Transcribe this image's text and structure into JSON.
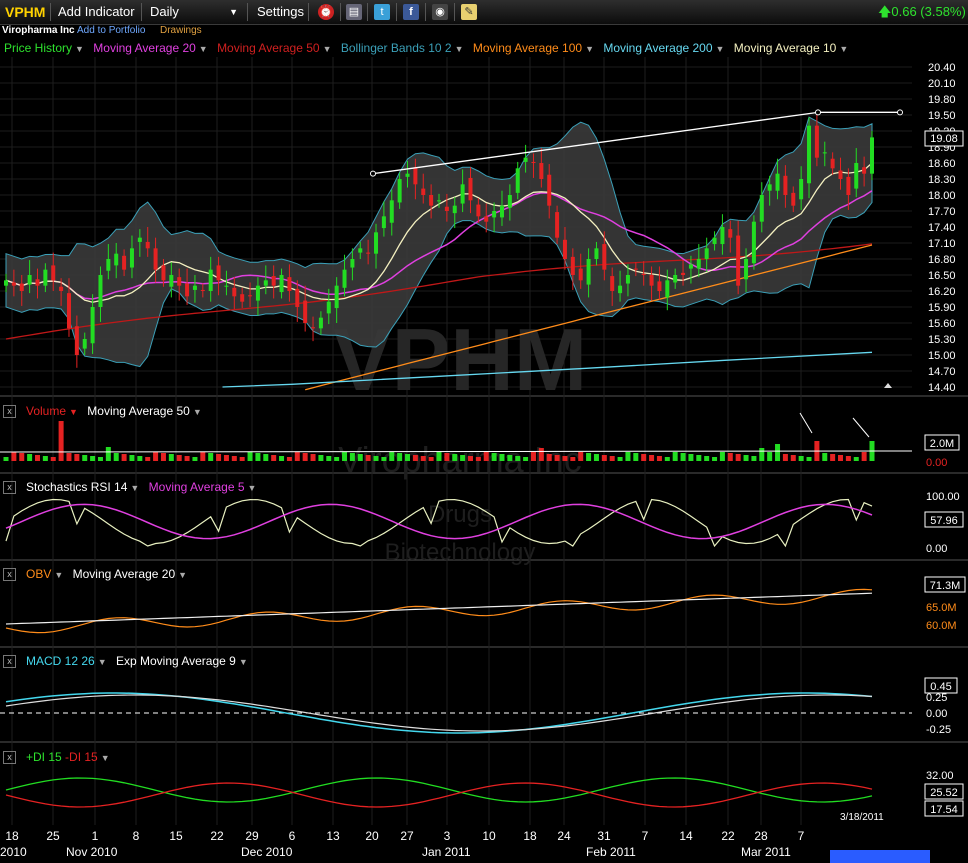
{
  "toolbar": {
    "symbol": "VPHM",
    "add_indicator": "Add Indicator",
    "interval": "Daily",
    "settings": "Settings",
    "change": "0.66 (3.58%)"
  },
  "subbar": {
    "company": "Viropharma Inc",
    "add_portfolio": "Add to Portfolio",
    "drawings": "Drawings"
  },
  "watermark": {
    "symbol": "VPHM",
    "company": "Viropharma Inc",
    "sector": "Drugs",
    "industry": "Biotechnology"
  },
  "legend": {
    "price": "Price History",
    "ma20": "Moving Average 20",
    "ma50": "Moving Average 50",
    "bb": "Bollinger Bands 10 2",
    "ma100": "Moving Average 100",
    "ma200": "Moving Average 200",
    "ma10": "Moving Average 10"
  },
  "panels": {
    "volume": {
      "title": "Volume",
      "ma": "Moving Average 50",
      "last": "2.0M",
      "zero": "0.00"
    },
    "stoch": {
      "title": "Stochastics RSI 14",
      "ma": "Moving Average 5",
      "last": "57.96"
    },
    "obv": {
      "title": "OBV",
      "ma": "Moving Average 20",
      "last": "71.3M"
    },
    "macd": {
      "title": "MACD 12 26",
      "ma": "Exp Moving Average 9",
      "last": "0.45"
    },
    "di": {
      "plus": "+DI 15",
      "minus": "-DI 15",
      "last_plus": "25.52",
      "last_minus": "17.54"
    }
  },
  "colors": {
    "up": "#22dd22",
    "down": "#e52222",
    "ma20": "#e040e0",
    "ma50": "#c01818",
    "bb": "#3ba0b8",
    "ma100": "#ff8c1a",
    "ma200": "#66d8f0",
    "ma10": "#f4f0c0"
  },
  "current_price": "19.08",
  "last_date": "3/18/2011",
  "chart_data": [
    {
      "type": "candlestick",
      "title": "VPHM",
      "price_axis": [
        "20.40",
        "20.10",
        "19.80",
        "19.50",
        "19.20",
        "18.90",
        "18.60",
        "18.30",
        "18.00",
        "17.70",
        "17.40",
        "17.10",
        "16.80",
        "16.50",
        "16.20",
        "15.90",
        "15.60",
        "15.30",
        "15.00",
        "14.70",
        "14.40"
      ],
      "ylim": [
        14.4,
        20.5
      ],
      "x_day_labels": [
        "18",
        "25",
        "1",
        "8",
        "15",
        "22",
        "29",
        "6",
        "13",
        "20",
        "27",
        "3",
        "10",
        "18",
        "24",
        "31",
        "7",
        "14",
        "22",
        "28",
        "7"
      ],
      "x_month_labels": [
        "2010",
        "Nov 2010",
        "Dec 2010",
        "Jan 2011",
        "Feb 2011",
        "Mar 2011"
      ],
      "close": [
        16.4,
        16.3,
        16.2,
        16.5,
        16.3,
        16.6,
        16.4,
        16.2,
        15.5,
        15.0,
        15.3,
        15.9,
        16.5,
        16.8,
        16.9,
        16.6,
        17.0,
        17.2,
        17.0,
        16.6,
        16.4,
        16.5,
        16.3,
        16.1,
        16.3,
        16.2,
        16.6,
        16.4,
        16.3,
        16.1,
        16.0,
        16.1,
        16.3,
        16.4,
        16.3,
        16.5,
        16.2,
        15.9,
        15.6,
        15.5,
        15.7,
        16.0,
        16.3,
        16.6,
        16.8,
        17.0,
        16.9,
        17.3,
        17.6,
        17.9,
        18.3,
        18.4,
        18.2,
        18.0,
        17.8,
        17.9,
        17.7,
        17.8,
        18.2,
        17.9,
        17.6,
        17.5,
        17.7,
        17.8,
        18.0,
        18.5,
        18.7,
        18.6,
        18.3,
        17.8,
        17.2,
        16.8,
        16.5,
        16.4,
        16.8,
        17.0,
        16.6,
        16.2,
        16.3,
        16.5,
        16.6,
        16.5,
        16.3,
        16.2,
        16.4,
        16.5,
        16.5,
        16.7,
        16.8,
        17.0,
        17.2,
        17.4,
        17.2,
        16.3,
        16.8,
        17.5,
        18.0,
        18.2,
        18.4,
        18.0,
        17.8,
        18.3,
        19.3,
        18.7,
        18.8,
        18.5,
        18.3,
        18.0,
        18.6,
        18.4,
        19.08
      ],
      "ma200": [
        {
          "x": 0.25,
          "y": 14.4
        },
        {
          "x": 0.33,
          "y": 14.45
        },
        {
          "x": 0.5,
          "y": 14.6
        },
        {
          "x": 0.67,
          "y": 14.75
        },
        {
          "x": 0.83,
          "y": 14.9
        },
        {
          "x": 1.0,
          "y": 15.05
        }
      ],
      "resistance_line": [
        {
          "date": "Dec 20",
          "price": 18.4
        },
        {
          "date": "Mar 10",
          "price": 19.55
        }
      ],
      "horizontal_line": 19.55
    },
    {
      "type": "bar",
      "title": "Volume",
      "ylim_labels": [
        "2.0M",
        "0.00"
      ],
      "spikes": [
        {
          "date": "Oct 25",
          "value": 3.2
        },
        {
          "date": "Mar 10",
          "value": 1.8
        },
        {
          "date": "Mar 18",
          "value": 2.0
        }
      ]
    },
    {
      "type": "line",
      "title": "Stochastics RSI 14",
      "axis": [
        "100.00",
        "0.00"
      ],
      "last": 57.96
    },
    {
      "type": "line",
      "title": "OBV",
      "axis": [
        "71.3M",
        "65.0M",
        "60.0M"
      ]
    },
    {
      "type": "line",
      "title": "MACD 12 26",
      "axis": [
        "0.45",
        "0.25",
        "0.00",
        "-0.25"
      ]
    },
    {
      "type": "line",
      "title": "DI 15",
      "axis": [
        "32.00",
        "25.52",
        "17.54"
      ]
    }
  ]
}
